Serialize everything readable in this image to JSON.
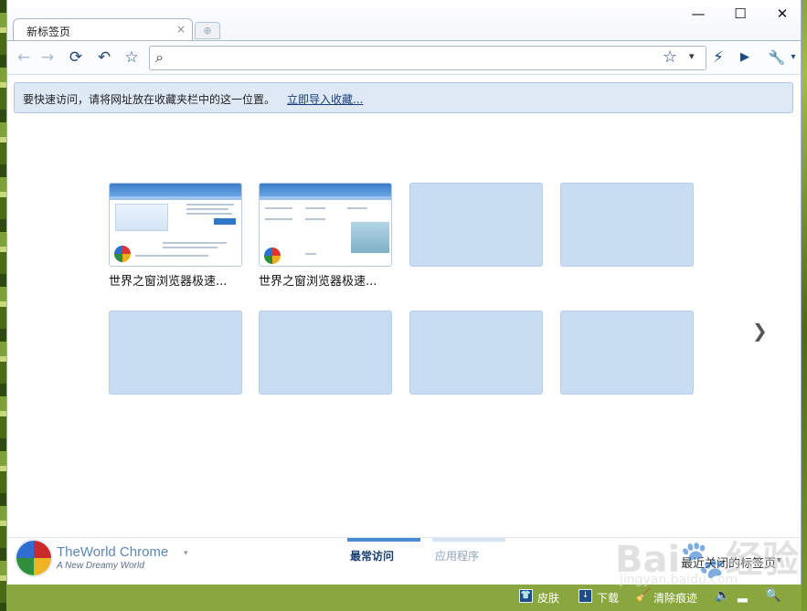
{
  "tab": {
    "title": "新标签页",
    "close": "×",
    "new_tab": "⊕"
  },
  "window_controls": {
    "minimize": "—",
    "maximize": "☐",
    "close": "✕"
  },
  "toolbar": {
    "back": "←",
    "forward": "→",
    "reload": "⟳",
    "undo": "↶",
    "star": "☆",
    "lightning": "⚡",
    "play": "▶",
    "wrench": "🔧",
    "dropdown": "▾"
  },
  "omnibox": {
    "value": "",
    "placeholder": "",
    "search_icon": "⌕",
    "star": "☆",
    "dropdown": "▾"
  },
  "bookmark_notice": {
    "text": "要快速访问，请将网址放在收藏夹栏中的这一位置。",
    "link": "立即导入收藏..."
  },
  "thumbnails": [
    {
      "label": "世界之窗浏览器极速..."
    },
    {
      "label": "世界之窗浏览器极速..."
    }
  ],
  "next_arrow": "❯",
  "footer": {
    "brand": "TheWorld Chrome",
    "slogan": "A New Dreamy World",
    "brand_chevron": "▾",
    "tabs": [
      {
        "label": "最常访问",
        "active": true
      },
      {
        "label": "应用程序",
        "active": false
      }
    ],
    "recent_closed": "最近关闭的标签页",
    "recent_chevron": "▾"
  },
  "statusbar": {
    "skin": "皮肤",
    "download": "下载",
    "clear": "清除痕迹"
  },
  "watermark": {
    "text": "Bai🐾经验",
    "sub": "jingyan.baidu.com"
  },
  "colors": {
    "accent": "#4a8ad4",
    "tile": "#c8dcf2",
    "statusbar": "#8aa73f"
  }
}
